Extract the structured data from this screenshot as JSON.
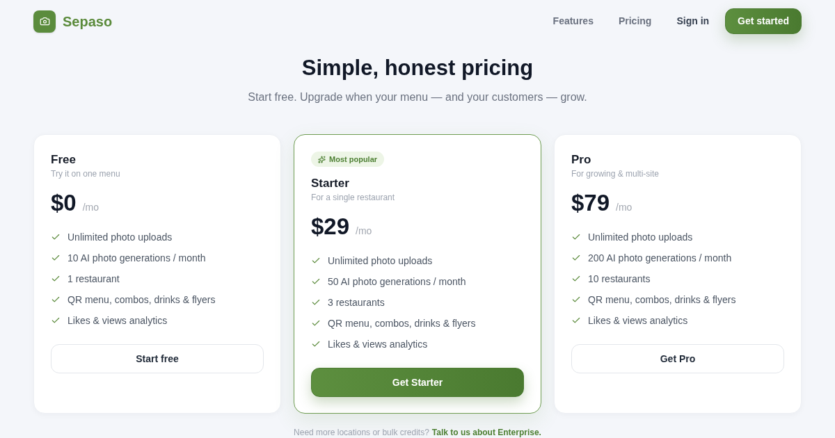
{
  "brand": {
    "name": "Sepaso"
  },
  "nav": {
    "links": [
      "Features",
      "Pricing"
    ],
    "sign_in": "Sign in",
    "cta": "Get started"
  },
  "hero": {
    "title": "Simple, honest pricing",
    "subtitle": "Start free. Upgrade when your menu — and your customers — grow."
  },
  "plans": [
    {
      "name": "Free",
      "tagline": "Try it on one menu",
      "price": "$0",
      "period": "/mo",
      "highlighted": false,
      "features": [
        "Unlimited photo uploads",
        "10 AI photo generations / month",
        "1 restaurant",
        "QR menu, combos, drinks & flyers",
        "Likes & views analytics"
      ],
      "button": {
        "label": "Start free",
        "kind": "outline"
      }
    },
    {
      "name": "Starter",
      "badge": "Most popular",
      "tagline": "For a single restaurant",
      "price": "$29",
      "period": "/mo",
      "highlighted": true,
      "features": [
        "Unlimited photo uploads",
        "50 AI photo generations / month",
        "3 restaurants",
        "QR menu, combos, drinks & flyers",
        "Likes & views analytics"
      ],
      "button": {
        "label": "Get Starter",
        "kind": "primary"
      }
    },
    {
      "name": "Pro",
      "tagline": "For growing & multi-site",
      "price": "$79",
      "period": "/mo",
      "highlighted": false,
      "features": [
        "Unlimited photo uploads",
        "200 AI photo generations / month",
        "10 restaurants",
        "QR menu, combos, drinks & flyers",
        "Likes & views analytics"
      ],
      "button": {
        "label": "Get Pro",
        "kind": "outline"
      }
    }
  ],
  "footer": {
    "note": "Need more locations or bulk credits?",
    "link": "Talk to us about Enterprise."
  }
}
